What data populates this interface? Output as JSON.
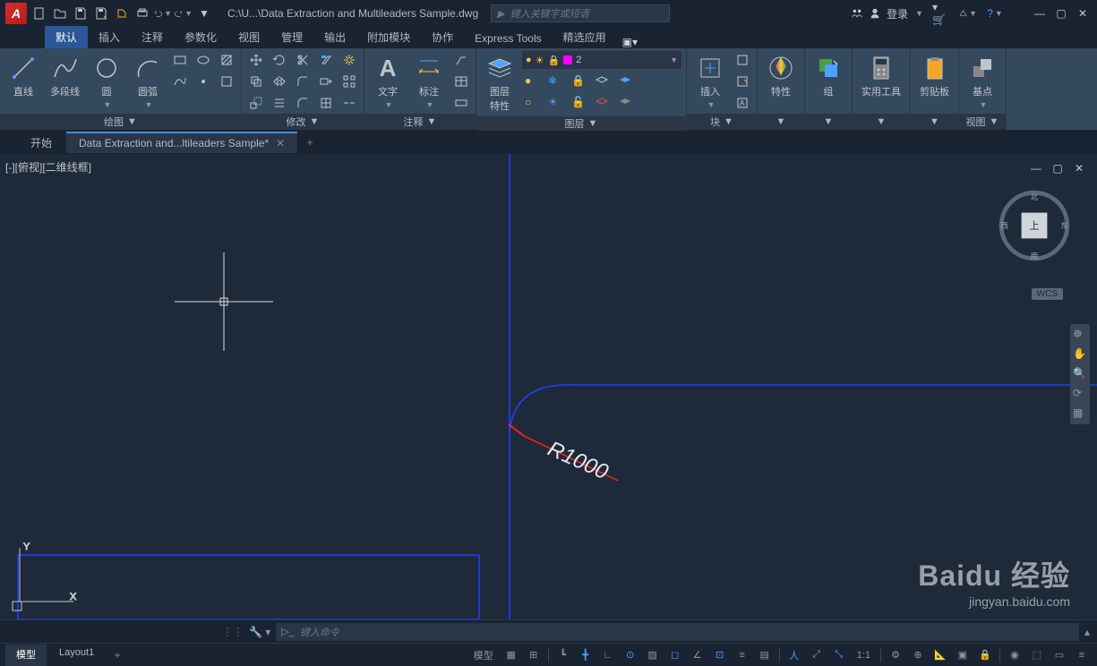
{
  "title": "C:\\U...\\Data Extraction and Multileaders Sample.dwg",
  "search_placeholder": "键入关键字或短语",
  "login_label": "登录",
  "ribbon_tabs": [
    "默认",
    "插入",
    "注释",
    "参数化",
    "视图",
    "管理",
    "输出",
    "附加模块",
    "协作",
    "Express Tools",
    "精选应用"
  ],
  "panels": {
    "draw": {
      "title": "绘图",
      "line": "直线",
      "polyline": "多段线",
      "circle": "圆",
      "arc": "圆弧"
    },
    "modify": {
      "title": "修改"
    },
    "annotate": {
      "title": "注释",
      "text": "文字",
      "dim": "标注"
    },
    "layers": {
      "title": "图层",
      "layerprop": "图层\n特性",
      "current_layer": "2"
    },
    "block": {
      "title": "块",
      "insert": "插入"
    },
    "properties": {
      "title": "特性",
      "btn": "特性"
    },
    "group": {
      "title": "",
      "btn": "组"
    },
    "util": {
      "title": "",
      "btn": "实用工具"
    },
    "clip": {
      "title": "",
      "btn": "剪贴板"
    },
    "view": {
      "title": "视图",
      "btn": "基点"
    }
  },
  "doc_tabs": {
    "start": "开始",
    "active": "Data Extraction and...ltileaders Sample*"
  },
  "viewport_label": "[-][俯视][二维线框]",
  "viewcube": {
    "n": "北",
    "s": "南",
    "e": "东",
    "w": "西",
    "top": "上"
  },
  "wcs": "WCS",
  "dimension_text": "R1000",
  "watermark": {
    "brand": "Baidu 经验",
    "url": "jingyan.baidu.com"
  },
  "command_placeholder": "键入命令",
  "layout_tabs": [
    "模型",
    "Layout1"
  ],
  "status": {
    "model": "模型",
    "scale": "1:1"
  }
}
